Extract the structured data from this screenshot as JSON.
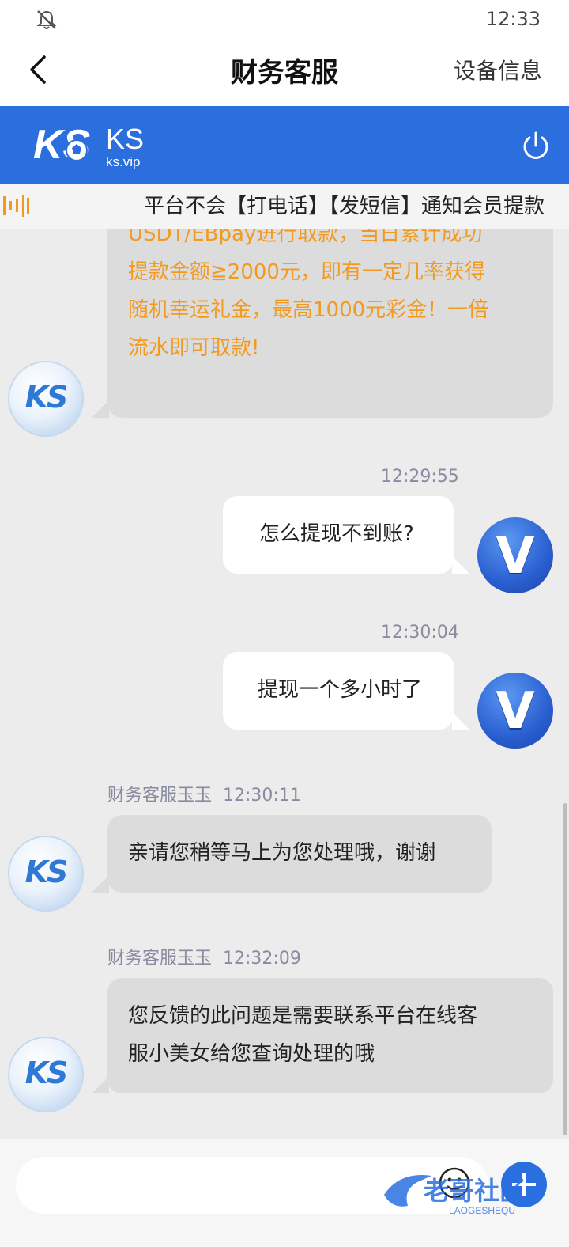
{
  "status_bar": {
    "time": "12:33"
  },
  "nav": {
    "title": "财务客服",
    "device_info": "设备信息"
  },
  "brand": {
    "logo_text": "KS",
    "logo_sub": "ks.vip",
    "color": "#2b6ede"
  },
  "marquee": {
    "text": "平台不会【打电话】【发短信】通知会员提款"
  },
  "messages": [
    {
      "lines": [
        "USDT/EBpay进行取款，当日累计成功",
        "提款金额≧2000元，即有一定几率获得",
        "随机幸运礼金，最高1000元彩金！一倍",
        "流水即可取款!"
      ]
    },
    {
      "time": "12:29:55",
      "text": "怎么提现不到账?"
    },
    {
      "time": "12:30:04",
      "text": "提现一个多小时了"
    },
    {
      "sender": "财务客服玉玉",
      "time": "12:30:11",
      "text": "亲请您稍等马上为您处理哦，谢谢"
    },
    {
      "sender": "财务客服玉玉",
      "time": "12:32:09",
      "lines": [
        "您反馈的此问题是需要联系平台在线客",
        "服小美女给您查询处理的哦"
      ]
    }
  ],
  "avatars": {
    "agent": "KS",
    "user": "V"
  },
  "watermark": {
    "text": "老哥社区",
    "sub": "LAOGESHEQU"
  },
  "colors": {
    "accent": "#2b6ede",
    "promo_text": "#f39a1e"
  }
}
